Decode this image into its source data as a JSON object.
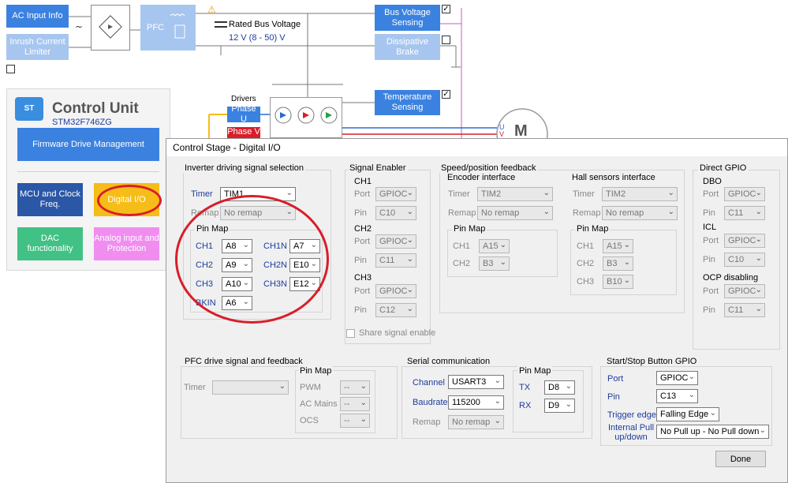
{
  "diagram": {
    "ac_input_info": "AC Input Info",
    "inrush_limiter": "Inrush Current Limiter",
    "pfc": "PFC",
    "rated_bus_voltage_label": "Rated Bus Voltage",
    "rated_bus_voltage_value": "12 V (8 - 50) V",
    "bus_voltage_sensing": "Bus Voltage Sensing",
    "dissipative_brake": "Dissipative Brake",
    "drivers_label": "Drivers",
    "phase_u": "Phase U",
    "phase_v": "Phase V",
    "temperature_sensing": "Temperature Sensing",
    "motor_label": "M",
    "phase_u_letter": "U",
    "phase_v_letter": "V",
    "control_unit_title": "Control Unit",
    "mcu_part": "STM32F746ZG",
    "firmware_tile": "Firmware Drive Management",
    "mcu_tile": "MCU and Clock Freq.",
    "digital_io_tile": "Digital I/O",
    "dac_tile": "DAC functionality",
    "analog_tile": "Analog input and Protection",
    "logo_text": "ST"
  },
  "dialog": {
    "title": "Control Stage - Digital I/O",
    "inverter": {
      "group_label": "Inverter driving signal selection",
      "timer_label": "Timer",
      "timer_value": "TIM1",
      "remap_label": "Remap",
      "remap_value": "No remap",
      "pinmap_label": "Pin Map",
      "ch1_label": "CH1",
      "ch1_value": "A8",
      "ch2_label": "CH2",
      "ch2_value": "A9",
      "ch3_label": "CH3",
      "ch3_value": "A10",
      "ch1n_label": "CH1N",
      "ch1n_value": "A7",
      "ch2n_label": "CH2N",
      "ch2n_value": "E10",
      "ch3n_label": "CH3N",
      "ch3n_value": "E12",
      "bkin_label": "BKIN",
      "bkin_value": "A6"
    },
    "signal_enabler": {
      "group_label": "Signal Enabler",
      "ch1": "CH1",
      "ch2": "CH2",
      "ch3": "CH3",
      "port_label": "Port",
      "pin_label": "Pin",
      "ch1_port": "GPIOC",
      "ch1_pin": "C10",
      "ch2_port": "GPIOC",
      "ch2_pin": "C11",
      "ch3_port": "GPIOC",
      "ch3_pin": "C12",
      "share_label": "Share signal enable"
    },
    "speed": {
      "group_label": "Speed/position feedback",
      "encoder_label": "Encoder interface",
      "hall_label": "Hall sensors interface",
      "timer_label": "Timer",
      "remap_label": "Remap",
      "pinmap_label": "Pin Map",
      "enc_timer": "TIM2",
      "enc_remap": "No remap",
      "enc_ch1_label": "CH1",
      "enc_ch1": "A15",
      "enc_ch2_label": "CH2",
      "enc_ch2": "B3",
      "hall_timer": "TIM2",
      "hall_remap": "No remap",
      "hall_ch1_label": "CH1",
      "hall_ch1": "A15",
      "hall_ch2_label": "CH2",
      "hall_ch2": "B3",
      "hall_ch3_label": "CH3",
      "hall_ch3": "B10"
    },
    "direct_gpio": {
      "group_label": "Direct GPIO",
      "dbo_label": "DBO",
      "icl_label": "ICL",
      "ocp_label": "OCP disabling",
      "port_label": "Port",
      "pin_label": "Pin",
      "dbo_port": "GPIOC",
      "dbo_pin": "C11",
      "icl_port": "GPIOC",
      "icl_pin": "C10",
      "ocp_port": "GPIOC",
      "ocp_pin": "C11"
    },
    "pfc": {
      "group_label": "PFC drive signal and feedback",
      "timer_label": "Timer",
      "timer_value": "",
      "pinmap_label": "Pin Map",
      "pwm_label": "PWM",
      "pwm_value": "--",
      "acmains_label": "AC Mains",
      "acmains_value": "--",
      "ocs_label": "OCS",
      "ocs_value": "--"
    },
    "serial": {
      "group_label": "Serial communication",
      "channel_label": "Channel",
      "channel_value": "USART3",
      "baud_label": "Baudrate",
      "baud_value": "115200",
      "remap_label": "Remap",
      "remap_value": "No remap",
      "pinmap_label": "Pin Map",
      "tx_label": "TX",
      "tx_value": "D8",
      "rx_label": "RX",
      "rx_value": "D9"
    },
    "startstop": {
      "group_label": "Start/Stop Button GPIO",
      "port_label": "Port",
      "port_value": "GPIOC",
      "pin_label": "Pin",
      "pin_value": "C13",
      "trigger_label": "Trigger edge",
      "trigger_value": "Falling Edge",
      "pull_label": "Internal Pull up/down",
      "pull_value": "No Pull up - No Pull down"
    },
    "done_label": "Done"
  },
  "colors": {
    "accent_blue": "#3b82e0",
    "highlight_red": "#d81e2a",
    "mcu_tile": "#2a57a6",
    "digital_io_tile": "#f6bd18",
    "dac_tile": "#41c184",
    "analog_tile": "#f08ef0"
  }
}
